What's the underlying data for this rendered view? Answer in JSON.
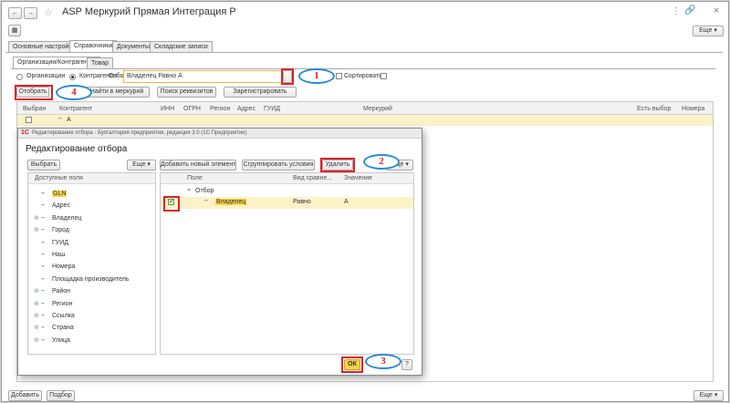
{
  "window": {
    "title": "ASP Меркурий Прямая Интеграция Р"
  },
  "main_tabs": [
    "Основные настройки",
    "Справочники",
    "Документы",
    "Складские записи"
  ],
  "sub_tabs": [
    "Организации/Контрагенты",
    "Товар"
  ],
  "top_more": "Еще",
  "filter": {
    "radio_org": "Организации",
    "radio_contr": "Контрагенты",
    "label": "Отбор:",
    "value": "Владелец Равно  А",
    "sort_label": "Сортировать:"
  },
  "actions": {
    "select": "Отобрать",
    "find_mercury": "Найти в меркурий",
    "find_requisites": "Поиск реквизитов",
    "register": "Зарегистрировать"
  },
  "grid": {
    "columns": [
      "Выбран",
      "Контрагент",
      "ИНН",
      "ОГРН",
      "Регион",
      "Адрес",
      "ГУИД",
      "Меркурий",
      "Есть выбор",
      "Номера"
    ],
    "row": {
      "name": "А"
    }
  },
  "dialog": {
    "titlebar": "Редактирование отбора - Бухгалтерия предприятия, редакция 3.0 (1С:Предприятие)",
    "heading": "Редактирование отбора",
    "select_btn": "Выбрать",
    "more": "Еще",
    "add_btn": "Добавить новый элемент",
    "group_btn": "Сгруппировать условия",
    "delete_btn": "Удалить",
    "left_header": "Доступные поля",
    "fields": [
      {
        "name": "GLN",
        "expand": false,
        "highlight": true
      },
      {
        "name": "Адрес",
        "expand": false,
        "highlight": false
      },
      {
        "name": "Владелец",
        "expand": true,
        "highlight": false
      },
      {
        "name": "Город",
        "expand": true,
        "highlight": false
      },
      {
        "name": "ГУИД",
        "expand": false,
        "highlight": false
      },
      {
        "name": "Наш",
        "expand": false,
        "highlight": false
      },
      {
        "name": "Номера",
        "expand": false,
        "highlight": false
      },
      {
        "name": "Площадка производитель",
        "expand": false,
        "highlight": false
      },
      {
        "name": "Район",
        "expand": true,
        "highlight": false
      },
      {
        "name": "Регион",
        "expand": true,
        "highlight": false
      },
      {
        "name": "Ссылка",
        "expand": true,
        "highlight": false
      },
      {
        "name": "Страна",
        "expand": true,
        "highlight": false
      },
      {
        "name": "Улица",
        "expand": true,
        "highlight": false
      }
    ],
    "right_headers": [
      "Поле",
      "Вид сравне...",
      "Значение"
    ],
    "root": "Отбор",
    "condition": {
      "field": "Владелец",
      "comparison": "Равно",
      "value": "А"
    },
    "ok": "ОК",
    "help": "?"
  },
  "callouts": [
    "1",
    "2",
    "3",
    "4"
  ],
  "footer": {
    "add": "Добавить",
    "select": "Подбор",
    "more": "Еще"
  }
}
